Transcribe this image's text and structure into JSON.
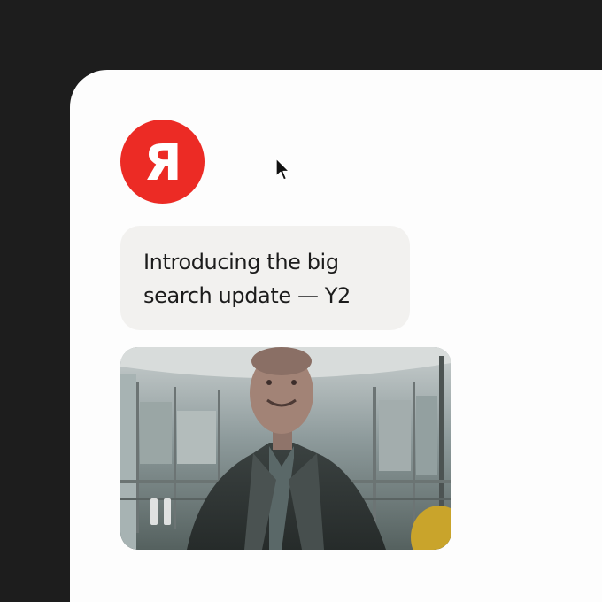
{
  "brand": {
    "logo_letter": "Я",
    "logo_color": "#ec2b25"
  },
  "message": {
    "text": "Introducing the big\nsearch update — Y2"
  },
  "video": {
    "state": "playing",
    "control_icon": "pause-icon"
  },
  "colors": {
    "background": "#1d1d1d",
    "card": "#fdfdfd",
    "bubble": "#f2f1ef"
  }
}
